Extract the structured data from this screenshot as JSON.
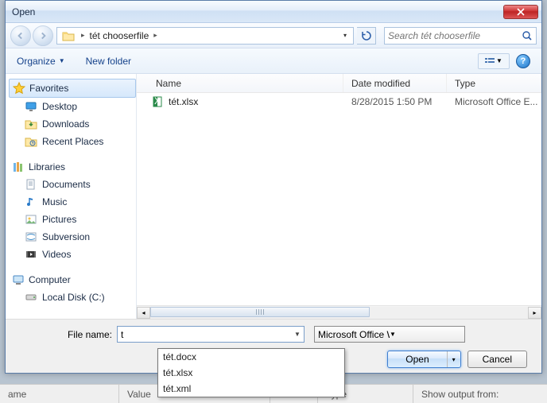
{
  "window": {
    "title": "Open"
  },
  "breadcrumb": {
    "segments": [
      "tét chooserfile"
    ]
  },
  "search": {
    "placeholder": "Search tét chooserfile"
  },
  "toolbar": {
    "organize": "Organize",
    "new_folder": "New folder"
  },
  "sidebar": {
    "favorites": {
      "label": "Favorites",
      "items": [
        "Desktop",
        "Downloads",
        "Recent Places"
      ]
    },
    "libraries": {
      "label": "Libraries",
      "items": [
        "Documents",
        "Music",
        "Pictures",
        "Subversion",
        "Videos"
      ]
    },
    "computer": {
      "label": "Computer",
      "items": [
        "Local Disk (C:)"
      ]
    }
  },
  "columns": {
    "name": "Name",
    "date": "Date modified",
    "type": "Type"
  },
  "files": [
    {
      "name": "tét.xlsx",
      "date": "8/28/2015 1:50 PM",
      "type": "Microsoft Office E..."
    }
  ],
  "filename": {
    "label": "File name:",
    "value": "t"
  },
  "filetype": {
    "label": "Microsoft Office Word Docume"
  },
  "buttons": {
    "open": "Open",
    "cancel": "Cancel"
  },
  "autocomplete": [
    "tét.docx",
    "tét.xlsx",
    "tét.xml"
  ],
  "underbar": {
    "name": "ame",
    "value": "Value",
    "type": "Type",
    "output": "Show output from:"
  }
}
